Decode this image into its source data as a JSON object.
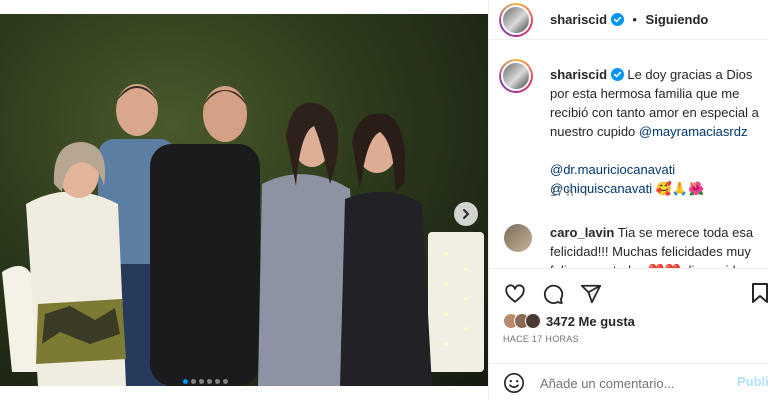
{
  "post": {
    "username": "shariscid",
    "follow_status": "Siguiendo",
    "separator": "•",
    "caption": "Le doy gracias a Dios por esta hermosa familia que me recibió con tanto amor en especial a nuestro cupido",
    "mention_main": "@mayramaciasrdz",
    "mention_2": "@dr.mauriciocanavati",
    "mention_3": "@chiquiscanavati",
    "emojis": "🥰🙏🌺",
    "time": "17 h",
    "likes": "3472 Me gusta",
    "posted_ago": "HACE 17 HORAS"
  },
  "comment": {
    "username": "caro_lavin",
    "text": "Tia se merece toda esa felicidad!!! Muchas felicidades muy feliz por ustedes ❤️❤️ dios cuide y"
  },
  "composer": {
    "placeholder": "Añade un comentario...",
    "publish_label": "Publicar"
  },
  "carousel": {
    "slides": 6,
    "active_index": 0
  },
  "colors": {
    "accent": "#0095f6",
    "link": "#00376b",
    "publish_disabled": "#b2dffc"
  },
  "icons": [
    "verified-icon",
    "heart-icon",
    "comment-icon",
    "share-icon",
    "save-icon",
    "emoji-icon",
    "chevron-right-icon"
  ]
}
